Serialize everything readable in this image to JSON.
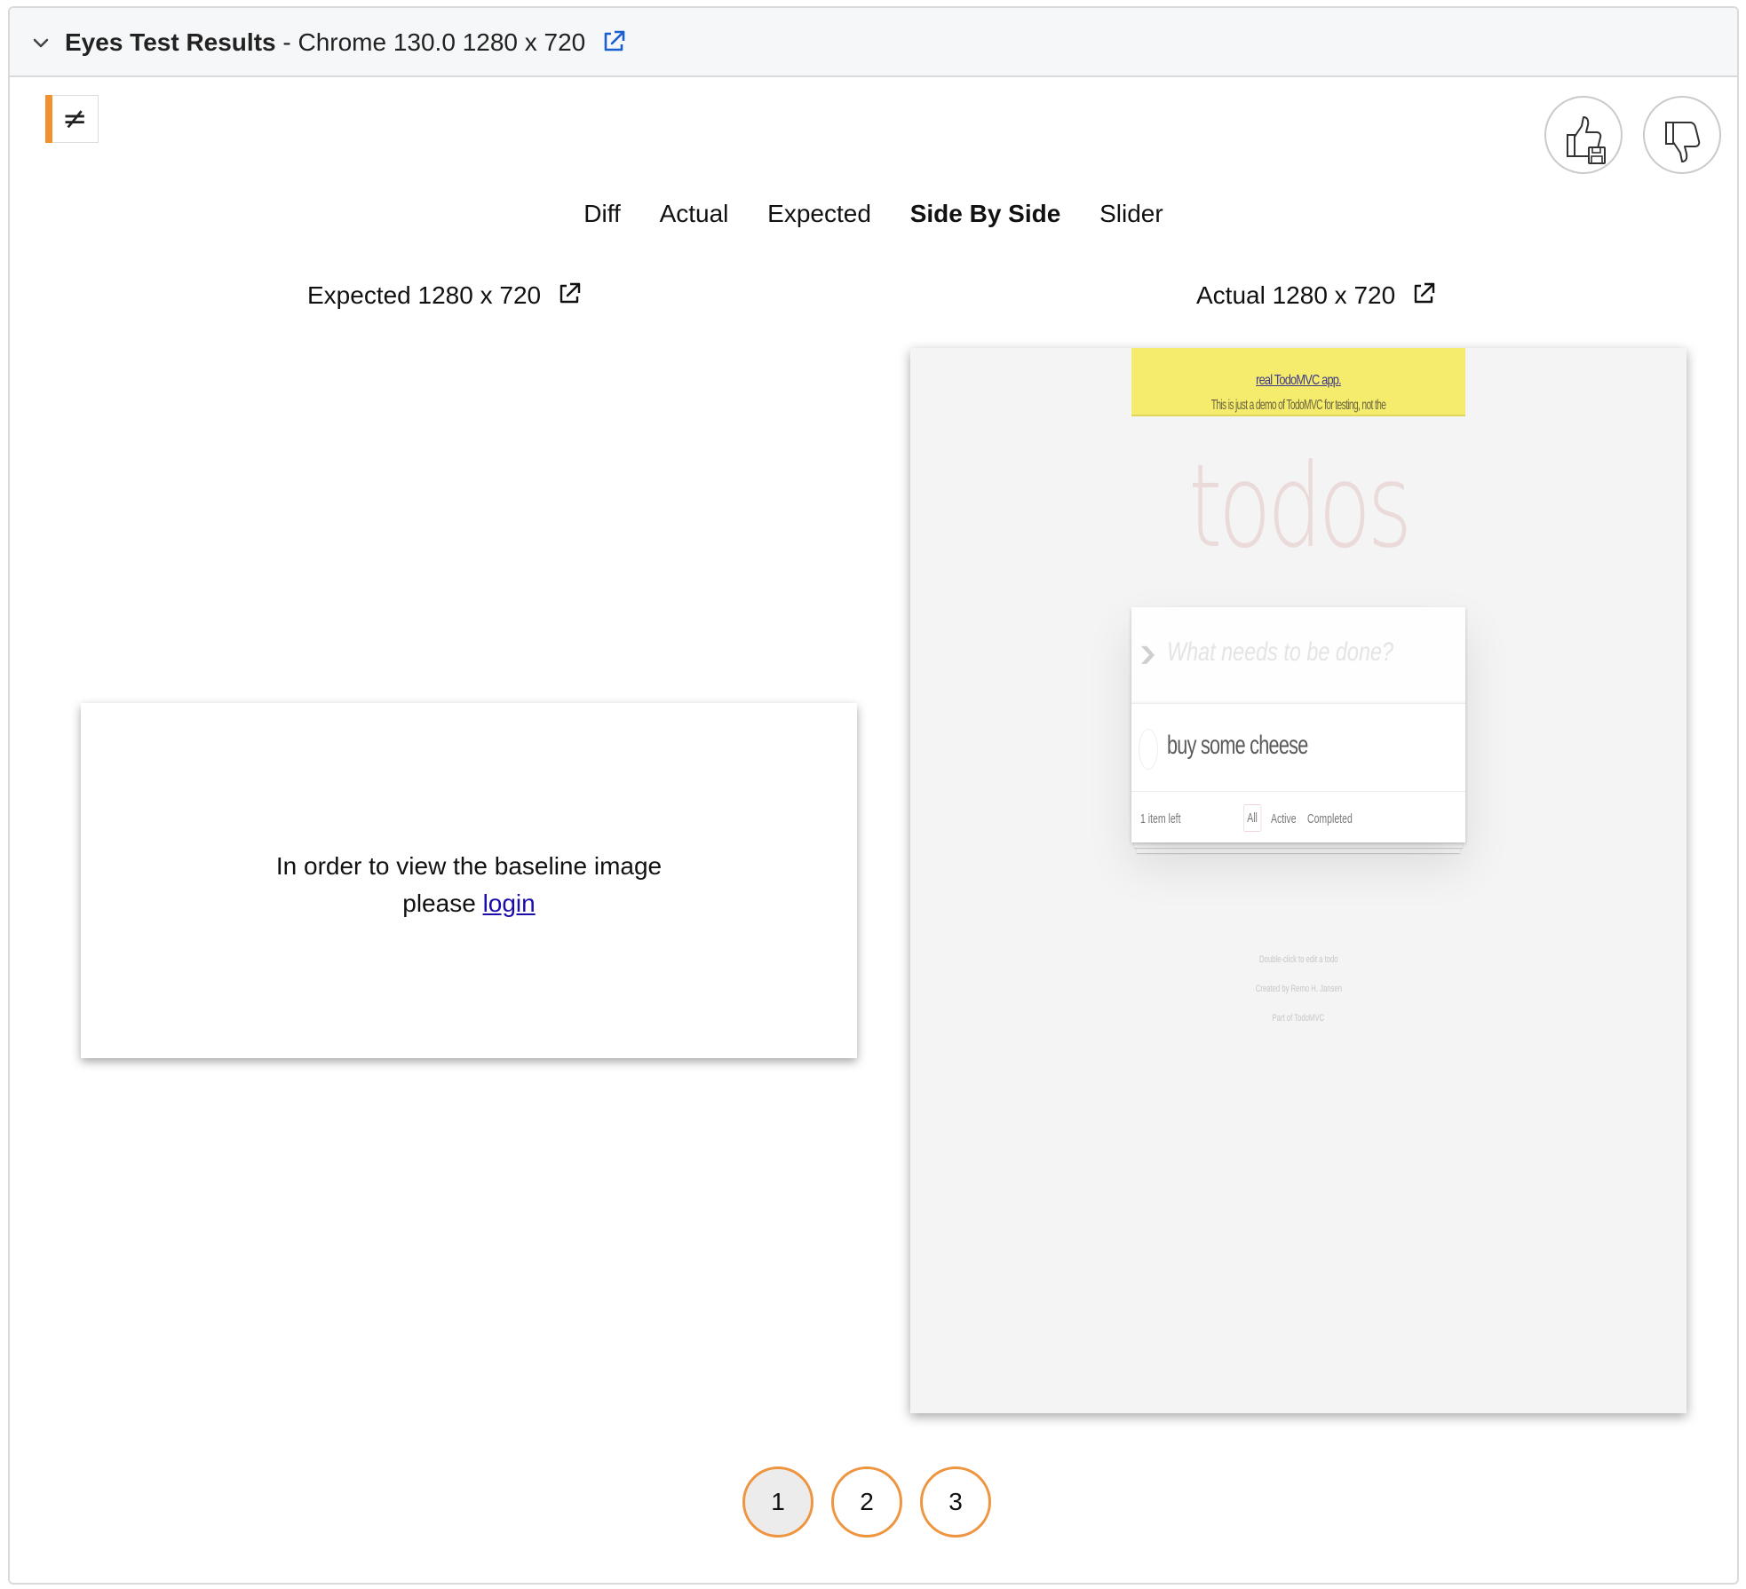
{
  "header": {
    "title_bold": "Eyes Test Results",
    "title_rest": " - Chrome 130.0 1280 x 720",
    "icons": {
      "collapse": "chevron-down-icon",
      "open": "external-link-icon"
    }
  },
  "status": {
    "symbol": "≠",
    "color": "#f0902e"
  },
  "actions": {
    "approve_icon": "thumbs-up-save-icon",
    "reject_icon": "thumbs-down-icon"
  },
  "tabs": [
    {
      "label": "Diff",
      "active": false
    },
    {
      "label": "Actual",
      "active": false
    },
    {
      "label": "Expected",
      "active": false
    },
    {
      "label": "Side By Side",
      "active": true
    },
    {
      "label": "Slider",
      "active": false
    }
  ],
  "expected": {
    "label": "Expected 1280 x 720",
    "message_line1": "In order to view the baseline image",
    "message_prefix": "please ",
    "login_link": "login"
  },
  "actual": {
    "label": "Actual 1280 x 720",
    "screenshot": {
      "banner_text": "This is just a demo of TodoMVC for testing, not the ",
      "banner_link": "real TodoMVC app.",
      "app_title": "todos",
      "input_placeholder": "What needs to be done?",
      "toggle_all": "❯",
      "todo_items": [
        "buy some cheese"
      ],
      "items_left": "1 item left",
      "filters": [
        "All",
        "Active",
        "Completed"
      ],
      "info_lines": [
        "Double-click to edit a todo",
        "Created by Remo H. Jansen",
        "Part of TodoMVC"
      ]
    }
  },
  "pagination": {
    "pages": [
      "1",
      "2",
      "3"
    ],
    "current": "1"
  },
  "colors": {
    "accent": "#ef9540",
    "link": "#1a0dab",
    "banner": "#f5ec6d"
  }
}
